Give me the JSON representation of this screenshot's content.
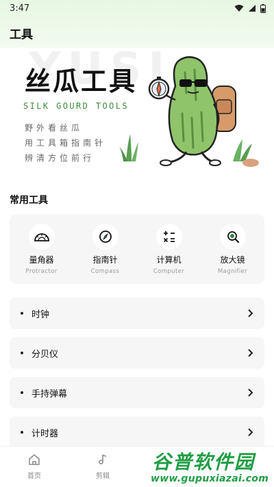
{
  "status_bar": {
    "time": "3:47"
  },
  "app": {
    "title": "工具"
  },
  "banner": {
    "ghost_text": "YUSI",
    "title": "丝瓜工具",
    "subtitle": "SILK GOURD TOOLS",
    "lines": [
      "野外看丝瓜",
      "用工具箱指南针",
      "辨清方位前行"
    ]
  },
  "section": {
    "title": "常用工具"
  },
  "tools": [
    {
      "name": "量角器",
      "en": "Protractor",
      "icon": "protractor-icon"
    },
    {
      "name": "指南针",
      "en": "Compass",
      "icon": "compass-icon"
    },
    {
      "name": "计算机",
      "en": "Computer",
      "icon": "calculator-icon"
    },
    {
      "name": "放大镜",
      "en": "Magnifier",
      "icon": "magnifier-icon"
    }
  ],
  "list": [
    {
      "label": "时钟"
    },
    {
      "label": "分贝仪"
    },
    {
      "label": "手持弹幕"
    },
    {
      "label": "计时器"
    }
  ],
  "nav": [
    {
      "label": "首页",
      "icon": "home-icon"
    },
    {
      "label": "剪辑",
      "icon": "music-note-icon"
    }
  ],
  "watermark": {
    "main": "谷普软件园",
    "url": "www.gupuxiazai.com"
  },
  "colors": {
    "accent": "#3f8a3a",
    "top_gradient": "#e6f7e2",
    "card_bg": "#f6f6f6",
    "watermark": "#1f9e43"
  }
}
